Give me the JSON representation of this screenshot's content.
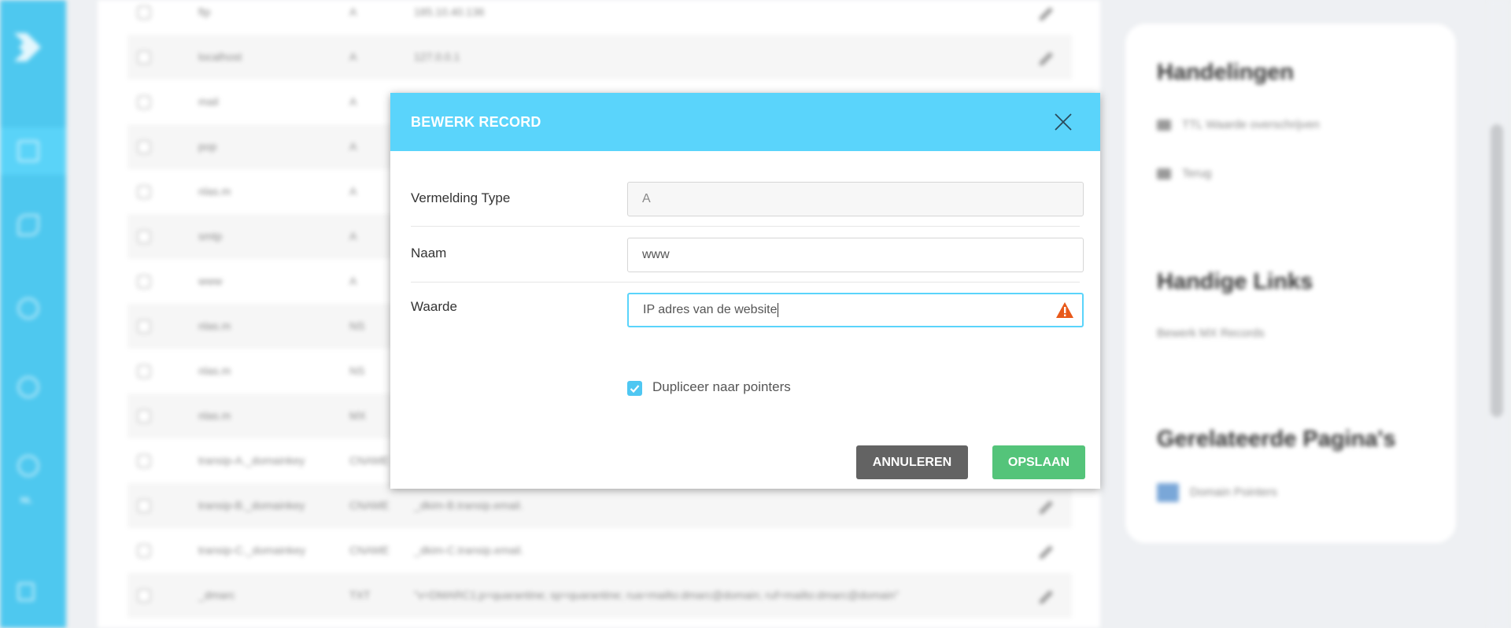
{
  "sidebar": {
    "items": [
      {
        "icon": "logo-icon"
      },
      {
        "icon": "list-icon"
      },
      {
        "icon": "tag-icon"
      },
      {
        "icon": "gear-icon"
      },
      {
        "icon": "globe-icon"
      },
      {
        "icon": "user-icon",
        "label": "NL"
      },
      {
        "icon": "logout-icon"
      }
    ]
  },
  "table": {
    "rows": [
      {
        "name": "ftp",
        "type": "A",
        "value": "185.10.40.136"
      },
      {
        "name": "localhost",
        "type": "A",
        "value": "127.0.0.1"
      },
      {
        "name": "mail",
        "type": "A",
        "value": ""
      },
      {
        "name": "pop",
        "type": "A",
        "value": ""
      },
      {
        "name": "nlas.m",
        "type": "A",
        "value": ""
      },
      {
        "name": "smtp",
        "type": "A",
        "value": ""
      },
      {
        "name": "www",
        "type": "A",
        "value": ""
      },
      {
        "name": "nlas.m",
        "type": "NS",
        "value": ""
      },
      {
        "name": "nlas.m",
        "type": "NS",
        "value": ""
      },
      {
        "name": "nlas.m",
        "type": "MX",
        "value": ""
      },
      {
        "name": "transip-A._domainkey",
        "type": "CNAME",
        "value": ""
      },
      {
        "name": "transip-B._domainkey",
        "type": "CNAME",
        "value": "_dkim-B.transip.email."
      },
      {
        "name": "transip-C._domainkey",
        "type": "CNAME",
        "value": "_dkim-C.transip.email."
      },
      {
        "name": "_dmarc",
        "type": "TXT",
        "value": "\"v=DMARC1;p=quarantine; sp=quarantine; rua=mailto:dmarc@domain; ruf=mailto:dmarc@domain\""
      }
    ]
  },
  "right_panel": {
    "actions_title": "Handelingen",
    "actions": [
      {
        "label": "TTL Waarde overschrijven",
        "icon": "plus-icon"
      },
      {
        "label": "Terug",
        "icon": "back-arrow-icon"
      }
    ],
    "links_title": "Handige Links",
    "links": [
      {
        "label": "Bewerk MX Records"
      }
    ],
    "related_title": "Gerelateerde Pagina's",
    "related": [
      {
        "label": "Domain Pointers",
        "icon": "domain-pointers-icon"
      }
    ]
  },
  "modal": {
    "title": "BEWERK RECORD",
    "close_icon": "close-icon",
    "fields": {
      "type": {
        "label": "Vermelding Type",
        "value": "A"
      },
      "name": {
        "label": "Naam",
        "value": "www",
        "suffix": ""
      },
      "value": {
        "label": "Waarde",
        "value": "IP adres van de website",
        "warning_icon": "warning-icon"
      }
    },
    "checkbox": {
      "label": "Dupliceer naar pointers",
      "checked": true
    },
    "buttons": {
      "cancel": "ANNULEREN",
      "save": "OPSLAAN"
    }
  },
  "colors": {
    "sidebar": "#4ec8ef",
    "modal_header": "#5ad4fb",
    "cancel_button": "#636363",
    "save_button": "#54c47a",
    "warning": "#e8591a"
  }
}
